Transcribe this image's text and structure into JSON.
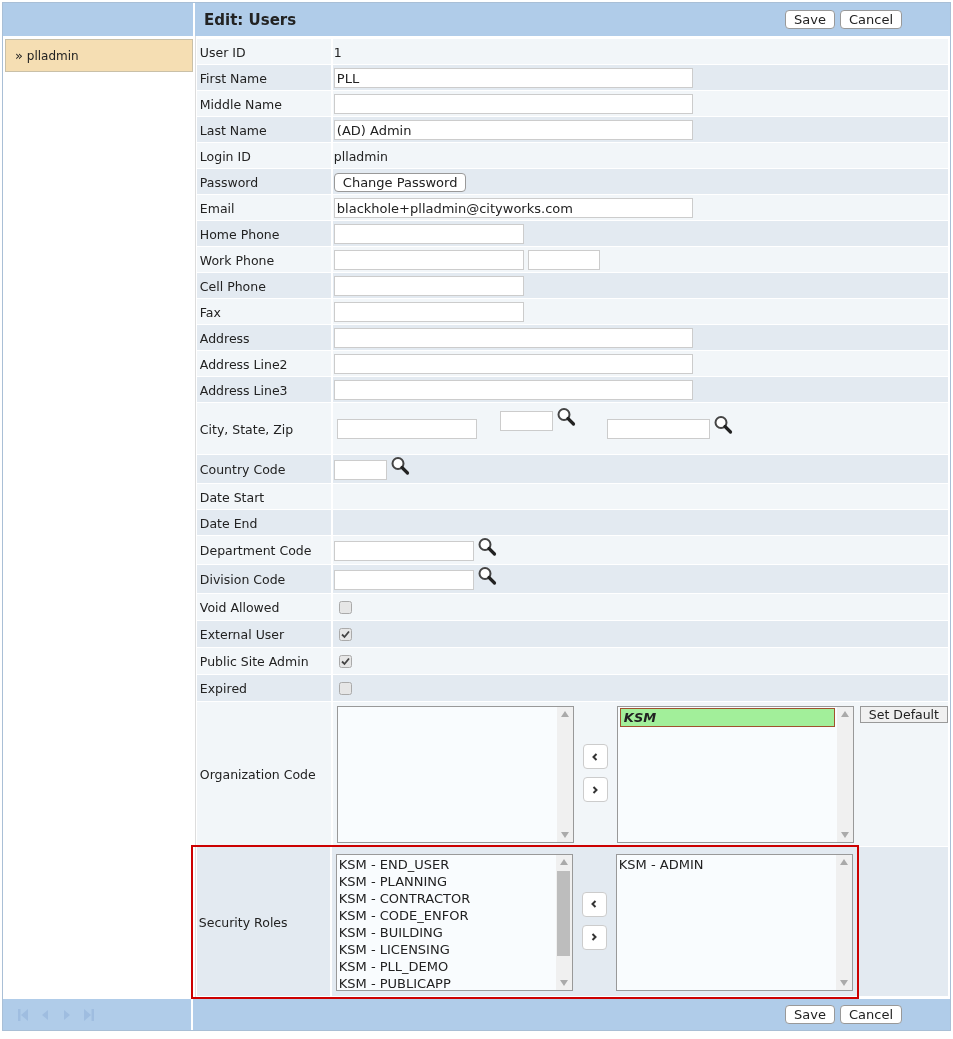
{
  "header": {
    "title": "Edit: Users",
    "buttons": [
      "Save",
      "Cancel"
    ]
  },
  "sidebar": {
    "items": [
      {
        "label": "plladmin",
        "icon": "»",
        "selected": true
      }
    ]
  },
  "fields": [
    {
      "label": "User ID",
      "kind": "text",
      "value": "1"
    },
    {
      "label": "First Name",
      "kind": "wide",
      "value": "PLL"
    },
    {
      "label": "Middle Name",
      "kind": "wide"
    },
    {
      "label": "Last Name",
      "kind": "wide",
      "value": "(AD) Admin"
    },
    {
      "label": "Login ID",
      "kind": "text",
      "value": "plladmin"
    },
    {
      "label": "Password",
      "kind": "button",
      "button": "Change Password"
    },
    {
      "label": "Email",
      "kind": "wide",
      "value": "blackhole+plladmin@cityworks.com"
    },
    {
      "label": "Home Phone",
      "kind": "short"
    },
    {
      "label": "Work Phone",
      "kind": "phone"
    },
    {
      "label": "Cell Phone",
      "kind": "short"
    },
    {
      "label": "Fax",
      "kind": "short"
    },
    {
      "label": "Address",
      "kind": "wide"
    },
    {
      "label": "Address Line2",
      "kind": "wide"
    },
    {
      "label": "Address Line3",
      "kind": "wide"
    },
    {
      "label": "City, State, Zip",
      "kind": "city"
    },
    {
      "label": "Country Code",
      "kind": "lookup-small"
    },
    {
      "label": "Date Start",
      "kind": "empty"
    },
    {
      "label": "Date End",
      "kind": "empty"
    },
    {
      "label": "Department Code",
      "kind": "lookup"
    },
    {
      "label": "Division Code",
      "kind": "lookup"
    },
    {
      "label": "Void Allowed",
      "kind": "checkbox",
      "checked": false
    },
    {
      "label": "External User",
      "kind": "checkbox",
      "checked": true
    },
    {
      "label": "Public Site Admin",
      "kind": "checkbox",
      "checked": true
    },
    {
      "label": "Expired",
      "kind": "checkbox",
      "checked": false
    },
    {
      "label": "Organization Code",
      "kind": "picklist",
      "highlighted": false,
      "button": "Set Default",
      "assigned": [
        {
          "text": "KSM",
          "default": true
        }
      ]
    },
    {
      "label": "Security Roles",
      "kind": "picklist",
      "highlighted": true,
      "available": [
        "KSM - END_USER",
        "KSM - PLANNING",
        "KSM - CONTRACTOR",
        "KSM - CODE_ENFOR",
        "KSM - BUILDING",
        "KSM - LICENSING",
        "KSM - PLL_DEMO",
        "KSM - PUBLICAPP"
      ],
      "assigned": [
        {
          "text": "KSM - ADMIN",
          "default": false
        }
      ]
    }
  ],
  "footer": {
    "buttons": [
      "Save",
      "Cancel"
    ]
  }
}
